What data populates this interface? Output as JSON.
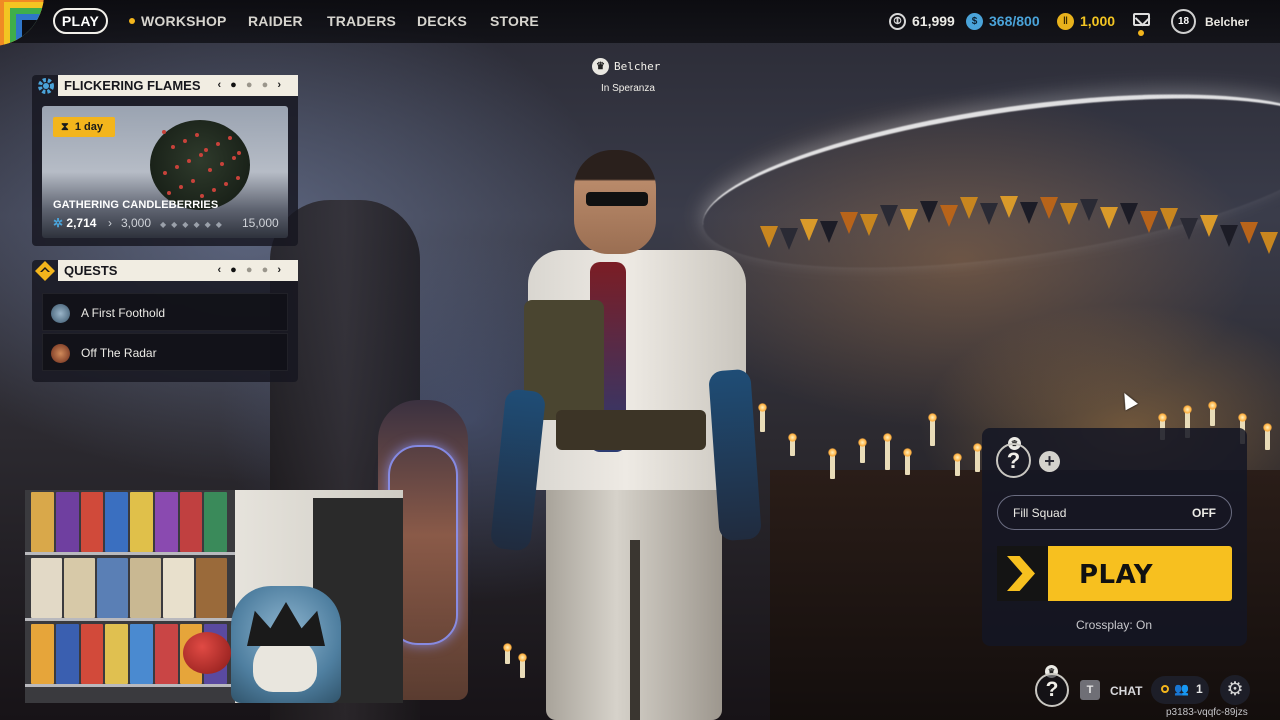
{
  "topnav": {
    "play": "PLAY",
    "workshop": "WORKSHOP",
    "raider": "RAIDER",
    "traders": "TRADERS",
    "decks": "DECKS",
    "store": "STORE"
  },
  "currencies": {
    "coins": "61,999",
    "credits": "368/800",
    "tokens": "1,000"
  },
  "profile": {
    "level": "18",
    "username": "Belcher"
  },
  "player_tag": {
    "name": "Belcher",
    "location": "In Speranza"
  },
  "event": {
    "header": "FLICKERING FLAMES",
    "timer": "1 day",
    "title": "GATHERING CANDLEBERRIES",
    "progress_current": "2,714",
    "progress_next": "3,000",
    "progress_max": "15,000",
    "page": 1,
    "pages": 3
  },
  "quests": {
    "header": "QUESTS",
    "items": [
      {
        "label": "A First Foothold"
      },
      {
        "label": "Off The Radar"
      }
    ],
    "page": 1,
    "pages": 3
  },
  "squad": {
    "empty_slot_glyph": "?",
    "fill_squad_label": "Fill Squad",
    "fill_squad_value": "OFF",
    "play_label": "PLAY",
    "crossplay": "Crossplay: On"
  },
  "bottombar": {
    "chat_key": "T",
    "chat_label": "CHAT",
    "party_count": "1",
    "build_id": "p3183-vqqfc-89jzs"
  },
  "colors": {
    "accent_yellow": "#f7c01f",
    "panel_header": "#f1ede2",
    "credits_blue": "#4aa3d9"
  }
}
